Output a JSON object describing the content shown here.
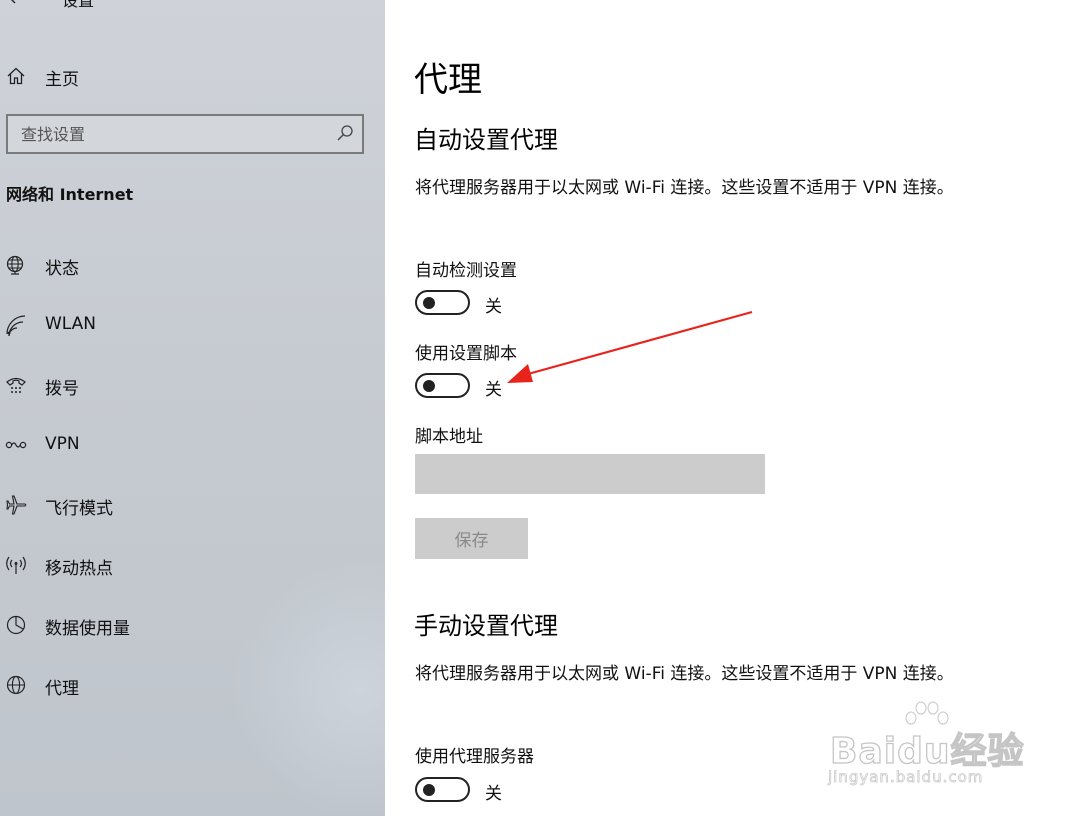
{
  "window": {
    "title": "设置"
  },
  "sidebar": {
    "home_label": "主页",
    "search_placeholder": "查找设置",
    "section_title": "网络和 Internet",
    "items": [
      {
        "label": "状态",
        "icon": "globe-monitor-icon"
      },
      {
        "label": "WLAN",
        "icon": "wifi-icon"
      },
      {
        "label": "拨号",
        "icon": "dialup-phone-icon"
      },
      {
        "label": "VPN",
        "icon": "vpn-icon"
      },
      {
        "label": "飞行模式",
        "icon": "airplane-icon"
      },
      {
        "label": "移动热点",
        "icon": "hotspot-icon"
      },
      {
        "label": "数据使用量",
        "icon": "data-usage-icon"
      },
      {
        "label": "代理",
        "icon": "globe-icon"
      }
    ]
  },
  "main": {
    "page_title": "代理",
    "auto_section": {
      "heading": "自动设置代理",
      "description": "将代理服务器用于以太网或 Wi-Fi 连接。这些设置不适用于 VPN 连接。",
      "auto_detect": {
        "label": "自动检测设置",
        "state": "关"
      },
      "use_script": {
        "label": "使用设置脚本",
        "state": "关"
      },
      "script_address": {
        "label": "脚本地址",
        "value": ""
      },
      "save_label": "保存"
    },
    "manual_section": {
      "heading": "手动设置代理",
      "description": "将代理服务器用于以太网或 Wi-Fi 连接。这些设置不适用于 VPN 连接。",
      "use_proxy": {
        "label": "使用代理服务器",
        "state": "关"
      }
    }
  },
  "annotation": {
    "arrow_color": "#e8231b"
  },
  "watermark": {
    "logo": "Baidu经验",
    "url": "jingyan.baidu.com"
  },
  "colors": {
    "sidebar_bg": "#c9cdd3",
    "input_bg": "#cccccc",
    "toggle_off": "#222222"
  }
}
